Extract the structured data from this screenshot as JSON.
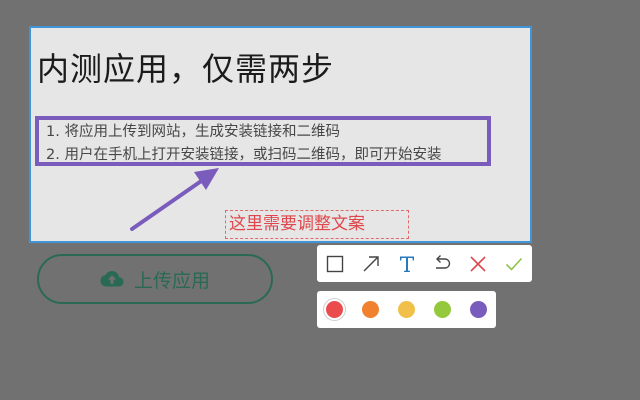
{
  "capture": {
    "title": "内测应用，仅需两步",
    "steps": [
      "1. 将应用上传到网站，生成安装链接和二维码",
      "2. 用户在手机上打开安装链接，或扫码二维码，即可开始安装"
    ],
    "annotation_text": "这里需要调整文案"
  },
  "upload_button": {
    "label": "上传应用",
    "icon": "cloud-upload-icon"
  },
  "toolbar": {
    "tools": [
      {
        "name": "rectangle-tool",
        "icon": "square-icon",
        "color": "#444444"
      },
      {
        "name": "arrow-tool",
        "icon": "arrow-icon",
        "color": "#444444"
      },
      {
        "name": "text-tool",
        "icon": "text-icon",
        "color": "#2b7ab8",
        "active": true
      },
      {
        "name": "undo-tool",
        "icon": "undo-icon",
        "color": "#444444"
      },
      {
        "name": "cancel-tool",
        "icon": "close-icon",
        "color": "#e0474c"
      },
      {
        "name": "confirm-tool",
        "icon": "check-icon",
        "color": "#8bc34a"
      }
    ]
  },
  "palette": {
    "colors": [
      "#ea4b4d",
      "#f0822f",
      "#f0c04a",
      "#95c93d",
      "#7a5cbd"
    ],
    "selected_index": 0
  },
  "colors": {
    "capture_border": "#3f95d8",
    "annotation_purple": "#7a5cbd",
    "annotation_red": "#e0474c",
    "overlay": "#717171",
    "upload_green": "#2a6a54"
  }
}
